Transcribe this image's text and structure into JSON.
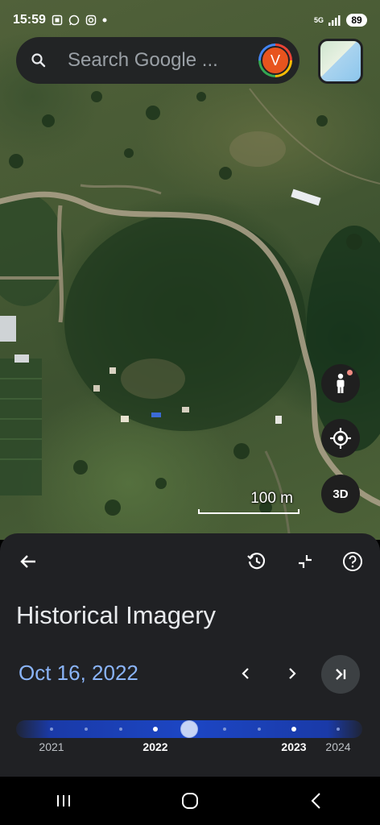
{
  "status_bar": {
    "time": "15:59",
    "notification_icons": [
      "screenshot-icon",
      "whatsapp-icon",
      "instagram-icon",
      "dot-icon"
    ],
    "network": "5G",
    "battery": "89"
  },
  "search": {
    "placeholder": "Search Google ...",
    "avatar_letter": "V"
  },
  "map": {
    "scale_label": "100 m",
    "controls": {
      "pegman": "pegman-icon",
      "location": "my-location-icon",
      "three_d_label": "3D"
    }
  },
  "historical_imagery": {
    "title": "Historical Imagery",
    "selected_date": "Oct 16, 2022",
    "timeline": {
      "years": [
        "2021",
        "2022",
        "2023",
        "2024"
      ],
      "selected_fraction": 0.5
    }
  },
  "colors": {
    "accent_blue": "#8ab4f8",
    "sheet_bg": "#202124",
    "timeline_blue": "#1c46c4"
  }
}
